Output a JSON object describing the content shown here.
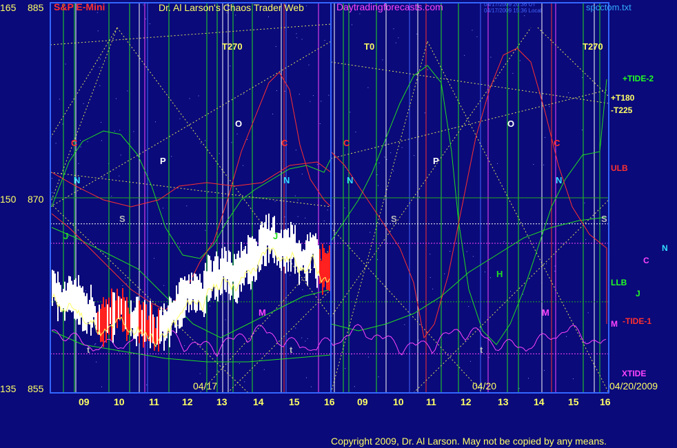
{
  "header": {
    "left_scale_top": "165",
    "price_top": "885",
    "instrument": "S&P E-Mini",
    "site_title": "Dr. Al Larson's Chaos Trader Web",
    "site_url": "Daytradingforecasts.com",
    "timestamp_1": "04/17/2009 20:36 UT",
    "timestamp_2": "04/17/2009 15:36 Local",
    "file_name": "spcctom.txt"
  },
  "left_scale": [
    {
      "a": "165",
      "b": "885"
    },
    {
      "a": "150",
      "b": "870"
    },
    {
      "a": "135",
      "b": "855"
    }
  ],
  "footer": {
    "copyright": "Copyright 2009, Dr. Al Larson. May not be copied by any means."
  },
  "chart_data": {
    "type": "line",
    "title": "S&P E-Mini",
    "ylim": [
      855,
      885
    ],
    "y_ticks": [
      855,
      870,
      885
    ],
    "grid": true,
    "x_tick_labels_day1": [
      "09",
      "10",
      "11",
      "12",
      "13",
      "14",
      "15",
      "16"
    ],
    "x_tick_labels_day2": [
      "09",
      "10",
      "11",
      "12",
      "13",
      "14",
      "15",
      "16"
    ],
    "date_labels": [
      "04/17",
      "04/20",
      "04/20/2009"
    ],
    "series": [
      {
        "name": "+TIDE-2",
        "color": "#22dd22"
      },
      {
        "name": "ULB",
        "color": "#ff3030"
      },
      {
        "name": "LLB",
        "color": "#22dd22"
      },
      {
        "name": "-TIDE-1",
        "color": "#ff3030"
      },
      {
        "name": "XTIDE",
        "color": "#ff44ff"
      }
    ],
    "right_labels": [
      {
        "text": "+TIDE-2",
        "color": "#22ff22"
      },
      {
        "text": "+T180",
        "color": "#ffff66"
      },
      {
        "text": "-T225",
        "color": "#ffff66"
      },
      {
        "text": "ULB",
        "color": "#ff3030"
      },
      {
        "text": "N",
        "color": "#33ddff"
      },
      {
        "text": "C",
        "color": "#ff44ff"
      },
      {
        "text": "LLB",
        "color": "#22ff22"
      },
      {
        "text": "J",
        "color": "#22ff22"
      },
      {
        "text": "M",
        "color": "#ff44ff"
      },
      {
        "text": "-TIDE-1",
        "color": "#ff3030"
      },
      {
        "text": "XTIDE",
        "color": "#ff44ff"
      }
    ],
    "annotations": [
      {
        "text": "T270",
        "color": "#ffff66"
      },
      {
        "text": "T0",
        "color": "#ffff66"
      },
      {
        "text": "T270",
        "color": "#ffff66"
      },
      {
        "text": "C",
        "color": "#ff3030"
      },
      {
        "text": "C",
        "color": "#ff3030"
      },
      {
        "text": "C",
        "color": "#ff3030"
      },
      {
        "text": "C",
        "color": "#ff3030"
      },
      {
        "text": "O",
        "color": "#ffffff"
      },
      {
        "text": "O",
        "color": "#ffffff"
      },
      {
        "text": "P",
        "color": "#ffffff"
      },
      {
        "text": "P",
        "color": "#ffffff"
      },
      {
        "text": "N",
        "color": "#33ddff"
      },
      {
        "text": "N",
        "color": "#33ddff"
      },
      {
        "text": "N",
        "color": "#33ddff"
      },
      {
        "text": "N",
        "color": "#33ddff"
      },
      {
        "text": "S",
        "color": "#bbbbbb"
      },
      {
        "text": "S",
        "color": "#bbbbbb"
      },
      {
        "text": "S",
        "color": "#bbbbbb"
      },
      {
        "text": "J",
        "color": "#22dd22"
      },
      {
        "text": "J",
        "color": "#22dd22"
      },
      {
        "text": "H",
        "color": "#22dd22"
      },
      {
        "text": "M",
        "color": "#ff44ff"
      },
      {
        "text": "M",
        "color": "#ff44ff"
      },
      {
        "text": "t",
        "color": "#bbbbbb"
      },
      {
        "text": "t",
        "color": "#bbbbbb"
      },
      {
        "text": "t",
        "color": "#bbbbbb"
      }
    ]
  },
  "colors": {
    "background": "#0a0a7a",
    "frame": "#3366ff",
    "price_bar": "#ffffff",
    "price_bar_down": "#ff2020",
    "grid": "#22aa22"
  }
}
